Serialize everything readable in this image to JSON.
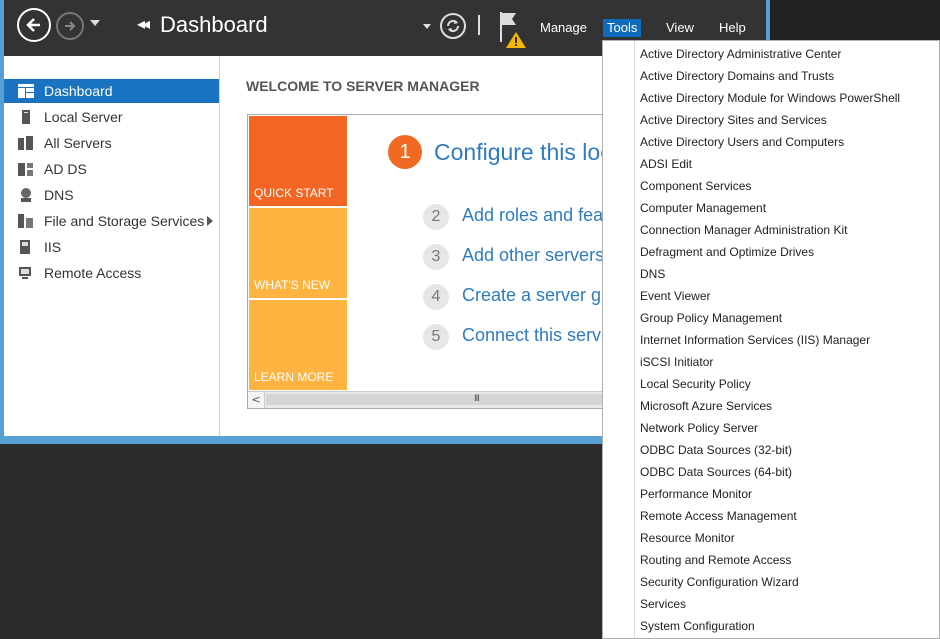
{
  "titlebar": {
    "breadcrumb_title": "Dashboard",
    "menu": {
      "manage": "Manage",
      "tools": "Tools",
      "view": "View",
      "help": "Help"
    }
  },
  "sidebar": {
    "items": [
      {
        "label": "Dashboard",
        "icon": "dashboard-icon",
        "selected": true
      },
      {
        "label": "Local Server",
        "icon": "server-icon"
      },
      {
        "label": "All Servers",
        "icon": "servers-icon"
      },
      {
        "label": "AD DS",
        "icon": "ad-ds-icon"
      },
      {
        "label": "DNS",
        "icon": "dns-icon"
      },
      {
        "label": "File and Storage Services",
        "icon": "storage-icon",
        "has_submenu": true
      },
      {
        "label": "IIS",
        "icon": "iis-icon"
      },
      {
        "label": "Remote Access",
        "icon": "remote-access-icon"
      }
    ]
  },
  "main": {
    "welcome_title": "WELCOME TO SERVER MANAGER",
    "tiles": {
      "quick_start": "QUICK START",
      "whats_new": "WHAT'S NEW",
      "learn_more": "LEARN MORE"
    },
    "steps": [
      {
        "number": "1",
        "text": "Configure this local server"
      },
      {
        "number": "2",
        "text": "Add roles and features"
      },
      {
        "number": "3",
        "text": "Add other servers to manage"
      },
      {
        "number": "4",
        "text": "Create a server group"
      },
      {
        "number": "5",
        "text": "Connect this server to cloud services"
      }
    ],
    "scroll_left": "<",
    "scroll_grip": "III"
  },
  "tools_menu": {
    "items": [
      "Active Directory Administrative Center",
      "Active Directory Domains and Trusts",
      "Active Directory Module for Windows PowerShell",
      "Active Directory Sites and Services",
      "Active Directory Users and Computers",
      "ADSI Edit",
      "Component Services",
      "Computer Management",
      "Connection Manager Administration Kit",
      "Defragment and Optimize Drives",
      "DNS",
      "Event Viewer",
      "Group Policy Management",
      "Internet Information Services (IIS) Manager",
      "iSCSI Initiator",
      "Local Security Policy",
      "Microsoft Azure Services",
      "Network Policy Server",
      "ODBC Data Sources (32-bit)",
      "ODBC Data Sources (64-bit)",
      "Performance Monitor",
      "Remote Access Management",
      "Resource Monitor",
      "Routing and Remote Access",
      "Security Configuration Wizard",
      "Services",
      "System Configuration"
    ],
    "highlighted_item": "Remote Access Management"
  },
  "colors": {
    "accent": "#1a73c0",
    "quick_start": "#f26522",
    "tile_light": "#ffb340",
    "step_link": "#2f7bbf",
    "highlight": "#f7f71c",
    "warning": "#f2b600"
  }
}
